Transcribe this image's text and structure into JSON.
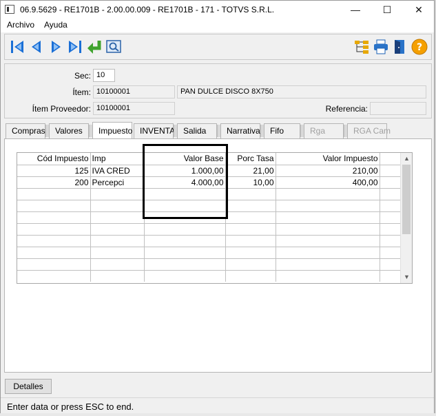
{
  "window": {
    "title": "06.9.5629 - RE1701B - 2.00.00.009 - RE1701B - 171 - TOTVS S.R.L.",
    "minimize": "—",
    "maximize": "☐",
    "close": "✕"
  },
  "menu": {
    "archivo": "Archivo",
    "ayuda": "Ayuda"
  },
  "toolbar": {
    "icons": [
      "first-icon",
      "prev-icon",
      "next-icon",
      "last-icon",
      "return-icon",
      "zoom-icon",
      "tree-icon",
      "print-icon",
      "exit-icon",
      "help-icon"
    ],
    "help_glyph": "?"
  },
  "form": {
    "sec_label": "Sec:",
    "sec_value": "10",
    "item_label": "Ítem:",
    "item_code": "10100001",
    "item_desc": "PAN DULCE DISCO 8X750",
    "item_proveedor_label": "Ítem Proveedor:",
    "item_proveedor_value": "10100001",
    "referencia_label": "Referencia:",
    "referencia_value": ""
  },
  "tabs": [
    {
      "label": "Compras"
    },
    {
      "label": "Valores"
    },
    {
      "label": "Impuesto"
    },
    {
      "label": "INVENTA"
    },
    {
      "label": "Salida"
    },
    {
      "label": "Narrativa"
    },
    {
      "label": "Fifo"
    },
    {
      "label": "Rga"
    },
    {
      "label": "RGA Cam"
    }
  ],
  "grid": {
    "headers": [
      "Cód Impuesto",
      "Imp",
      "Valor Base",
      "Porc Tasa",
      "Valor Impuesto"
    ],
    "rows": [
      [
        "125",
        "IVA CRED",
        "1.000,00",
        "21,00",
        "210,00"
      ],
      [
        "200",
        "Percepci",
        "4.000,00",
        "10,00",
        "400,00"
      ]
    ]
  },
  "detalles_label": "Detalles",
  "status": "Enter data or press ESC to end.",
  "colors": {
    "nav_blue": "#1a6fd6",
    "help_orange": "#f5a000",
    "return_green": "#3fa32e"
  }
}
